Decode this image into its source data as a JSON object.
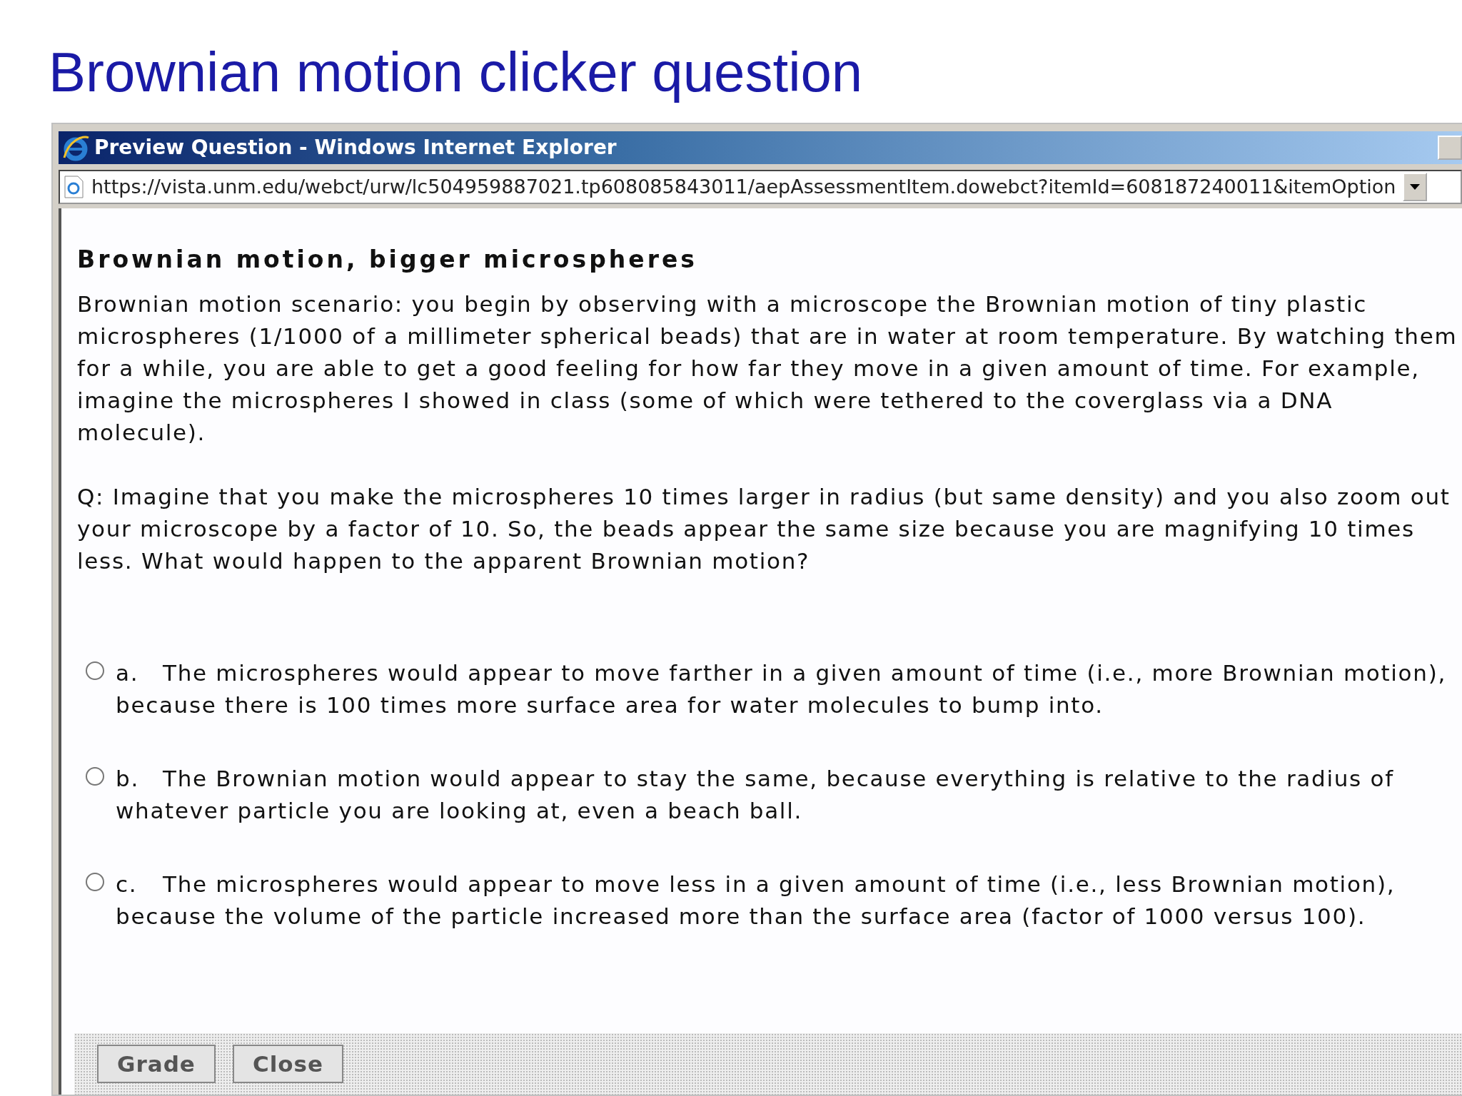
{
  "slide_title": "Brownian motion clicker question",
  "window": {
    "title": "Preview Question - Windows Internet Explorer",
    "address": "https://vista.unm.edu/webct/urw/lc504959887021.tp608085843011/aepAssessmentItem.dowebct?itemId=608187240011&itemOption"
  },
  "question": {
    "title": "Brownian motion, bigger microspheres",
    "paragraphs": [
      "Brownian motion scenario: you begin by observing with a microscope the Brownian motion of tiny plastic microspheres (1/1000 of a millimeter spherical beads) that are in water at room temperature. By watching them for a while, you are able to get a good feeling for how far they move in a given amount of time. For example, imagine the microspheres I showed in class (some of which were tethered to the coverglass via a DNA molecule).",
      "Q: Imagine that you make the microspheres 10 times larger in radius (but same density) and you also zoom out your microscope by a factor of 10. So, the beads appear the same size because you are magnifying 10 times less. What would happen to the apparent Brownian motion?"
    ]
  },
  "options": [
    {
      "letter": "a.",
      "text": "The microspheres would appear to move farther in a given amount of time (i.e., more Brownian motion), because there is 100 times more surface area for water molecules to bump into.",
      "selected": false
    },
    {
      "letter": "b.",
      "text": "The Brownian motion would appear to stay the same, because everything is relative to the radius of whatever particle you are looking at, even a beach ball.",
      "selected": false
    },
    {
      "letter": "c.",
      "text": "The microspheres would appear to move less in a given amount of time (i.e., less Brownian motion), because the volume of the particle increased more than the surface area (factor of 1000 versus 100).",
      "selected": false
    }
  ],
  "buttons": [
    "Grade",
    "Close"
  ]
}
